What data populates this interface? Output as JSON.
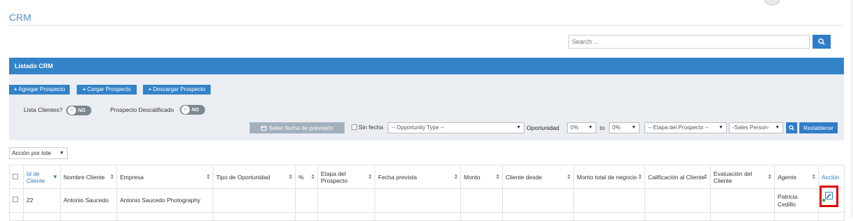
{
  "page": {
    "title": "CRM"
  },
  "search": {
    "placeholder": "Search ..."
  },
  "panel": {
    "title": "Listado CRM",
    "buttons": [
      "Agregar Prospecto",
      "Cargar Prospecto",
      "Descargar Prospecto"
    ],
    "toggles": [
      {
        "label": "Lista Clientes?",
        "state": "NO"
      },
      {
        "label": "Prospecto Descalificado",
        "state": "NO"
      }
    ],
    "filters": {
      "date_button": "Selec fecha de previsión",
      "sin_fecha": "Sin fecha",
      "opportunity_type": "-- Opportunity Type --",
      "oportunidad_label": "Oportunidad",
      "pct_from": "0%",
      "to_label": "to",
      "pct_to": "0%",
      "etapa": "-- Etapa del Prospecto --",
      "sales_person": "-Sales Person-",
      "reset": "Restablecer"
    }
  },
  "bulk_action": "Acción por lote",
  "table": {
    "headers": [
      "Id de Cliente",
      "Nombre Cliente",
      "Empresa",
      "Tipo de Oportunidad",
      "%",
      "Etapa del Prospecto",
      "Fecha prevista",
      "Monto",
      "Cliente desde",
      "Monto total de negocio",
      "Calificación al Cliente",
      "Evaluación del Cliente",
      "Agente",
      "Acción"
    ],
    "rows": [
      {
        "id": "22",
        "nombre": "Antonio Saucedo",
        "empresa": "Antonio Saucedo Photography",
        "tipo": "",
        "pct": "",
        "etapa": "",
        "fecha": "",
        "monto": "",
        "desde": "",
        "total": "",
        "calificacion": "",
        "evaluacion": "",
        "agente": "Patricia Cedillo"
      }
    ]
  },
  "colors": {
    "accent": "#3383c9",
    "highlight": "#e10000",
    "view_icon": "#3aab4c"
  }
}
